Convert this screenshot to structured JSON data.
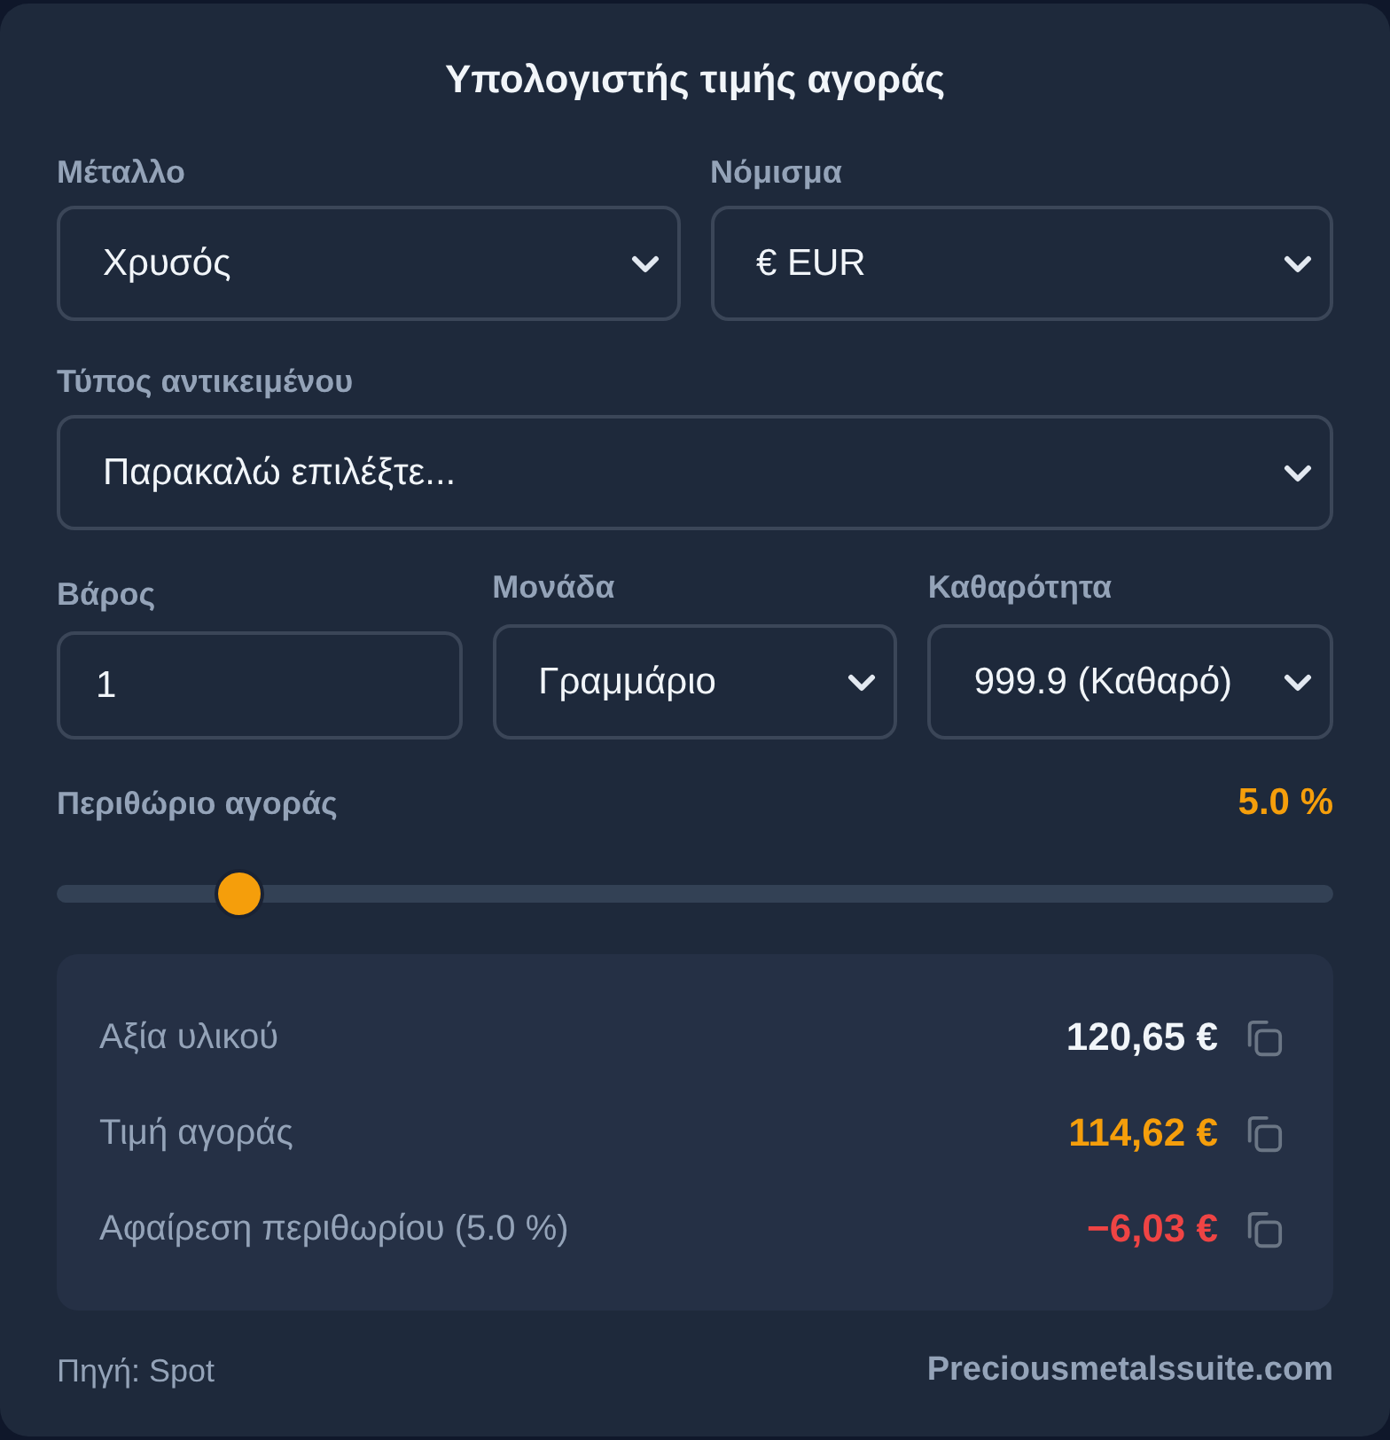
{
  "title": "Υπολογιστής τιμής αγοράς",
  "rows": [
    [
      {
        "label": "Μέταλλο",
        "kind": "select",
        "value": "Χρυσός"
      },
      {
        "label": "Νόμισμα",
        "kind": "select",
        "value": "€ EUR"
      }
    ],
    [
      {
        "label": "Τύπος αντικειμένου",
        "kind": "select",
        "placeholder": "Παρακαλώ επιλέξτε..."
      }
    ],
    [
      {
        "label": "Βάρος",
        "kind": "input",
        "value": "1"
      },
      {
        "label": "Μονάδα",
        "kind": "select",
        "value": "Γραμμάριο"
      },
      {
        "label": "Καθαρότητα",
        "kind": "select",
        "value": "999.9 (Καθαρό)"
      }
    ]
  ],
  "margin": {
    "label": "Περιθώριο αγοράς",
    "reading": "5.0 %",
    "level": 0.143
  },
  "results": [
    {
      "label": "Αξία υλικού",
      "value": "120,65 €",
      "color": "#f1f5f9"
    },
    {
      "label": "Τιμή αγοράς",
      "value": "114,62 €",
      "color": "#f59e0b"
    },
    {
      "label": "Αφαίρεση περιθωρίου (5.0 %)",
      "value": "−6,03 €",
      "color": "#ef4444"
    }
  ],
  "footer": {
    "source": "Πηγή: Spot",
    "link": "Preciousmetalssuite.com"
  }
}
